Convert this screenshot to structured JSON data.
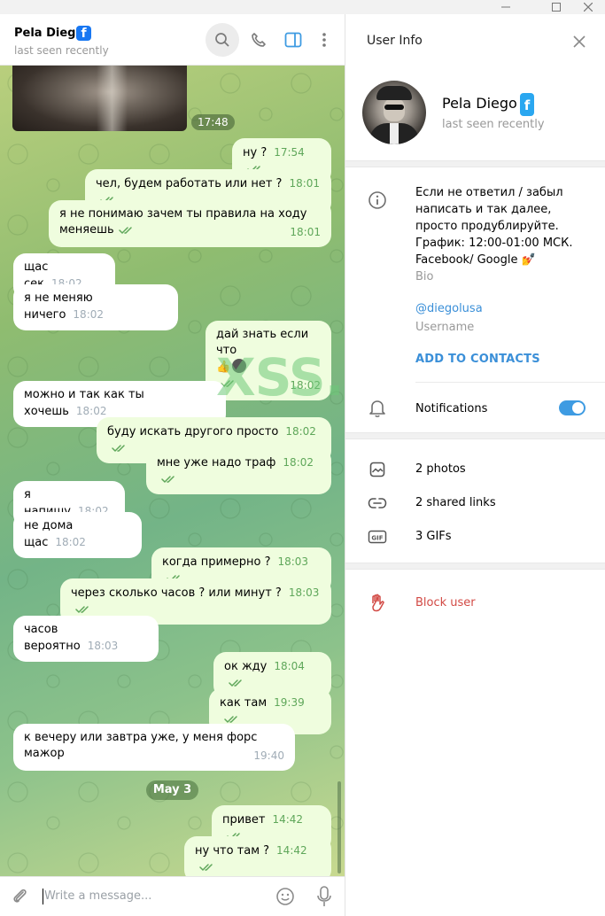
{
  "chat": {
    "peer_name": "Pela Diego",
    "peer_badge": "f",
    "peer_status": "last seen recently",
    "photo_time": "17:48",
    "date_divider": "May 3",
    "composer_placeholder": "Write a message...",
    "watermark": "XSS.is",
    "messages": [
      {
        "dir": "out",
        "text": "ну ?",
        "time": "17:54"
      },
      {
        "dir": "out",
        "text": "чел, будем работать или нет ?",
        "time": "18:01"
      },
      {
        "dir": "out",
        "text": "я не понимаю зачем ты правила на ходу меняешь",
        "time": "18:01"
      },
      {
        "dir": "in",
        "text": "щас сек",
        "time": "18:02"
      },
      {
        "dir": "in",
        "text": "я не меняю ничего",
        "time": "18:02"
      },
      {
        "dir": "out",
        "text": "дай знать если что",
        "time": "18:02"
      },
      {
        "dir": "in",
        "text": "можно и так как ты хочешь",
        "time": "18:02"
      },
      {
        "dir": "out",
        "text": "буду искать другого просто",
        "time": "18:02"
      },
      {
        "dir": "out",
        "text": "мне уже надо траф",
        "time": "18:02"
      },
      {
        "dir": "in",
        "text": "я напишу",
        "time": "18:02"
      },
      {
        "dir": "in",
        "text": "не дома щас",
        "time": "18:02"
      },
      {
        "dir": "out",
        "text": "когда примерно ?",
        "time": "18:03"
      },
      {
        "dir": "out",
        "text": "через сколько часов ? или минут ?",
        "time": "18:03"
      },
      {
        "dir": "in",
        "text": "часов вероятно",
        "time": "18:03"
      },
      {
        "dir": "out",
        "text": "ок жду",
        "time": "18:04"
      },
      {
        "dir": "out",
        "text": "как там",
        "time": "19:39"
      },
      {
        "dir": "in",
        "text": "к вечеру или завтра уже, у меня форс мажор",
        "time": "19:40"
      },
      {
        "dir": "out",
        "text": "привет",
        "time": "14:42"
      },
      {
        "dir": "out",
        "text": "ну что там ?",
        "time": "14:42"
      }
    ]
  },
  "info": {
    "title": "User Info",
    "name": "Pela Diego",
    "badge": "f",
    "status": "last seen recently",
    "bio": "Если не ответил / забыл написать и так далее, просто продублируйте. График: 12:00-01:00 МСК. Facebook/ Google 💅",
    "bio_label": "Bio",
    "username": "@diegolusa",
    "username_label": "Username",
    "add_contacts": "ADD TO CONTACTS",
    "notifications_label": "Notifications",
    "notifications_on": true,
    "photos": "2 photos",
    "shared_links": "2 shared links",
    "gifs": "3 GIFs",
    "block": "Block user"
  },
  "colors": {
    "accent": "#3e9be2",
    "outgoing_bubble": "#effdde",
    "danger": "#d24a45",
    "time_out": "#5fa75a"
  }
}
